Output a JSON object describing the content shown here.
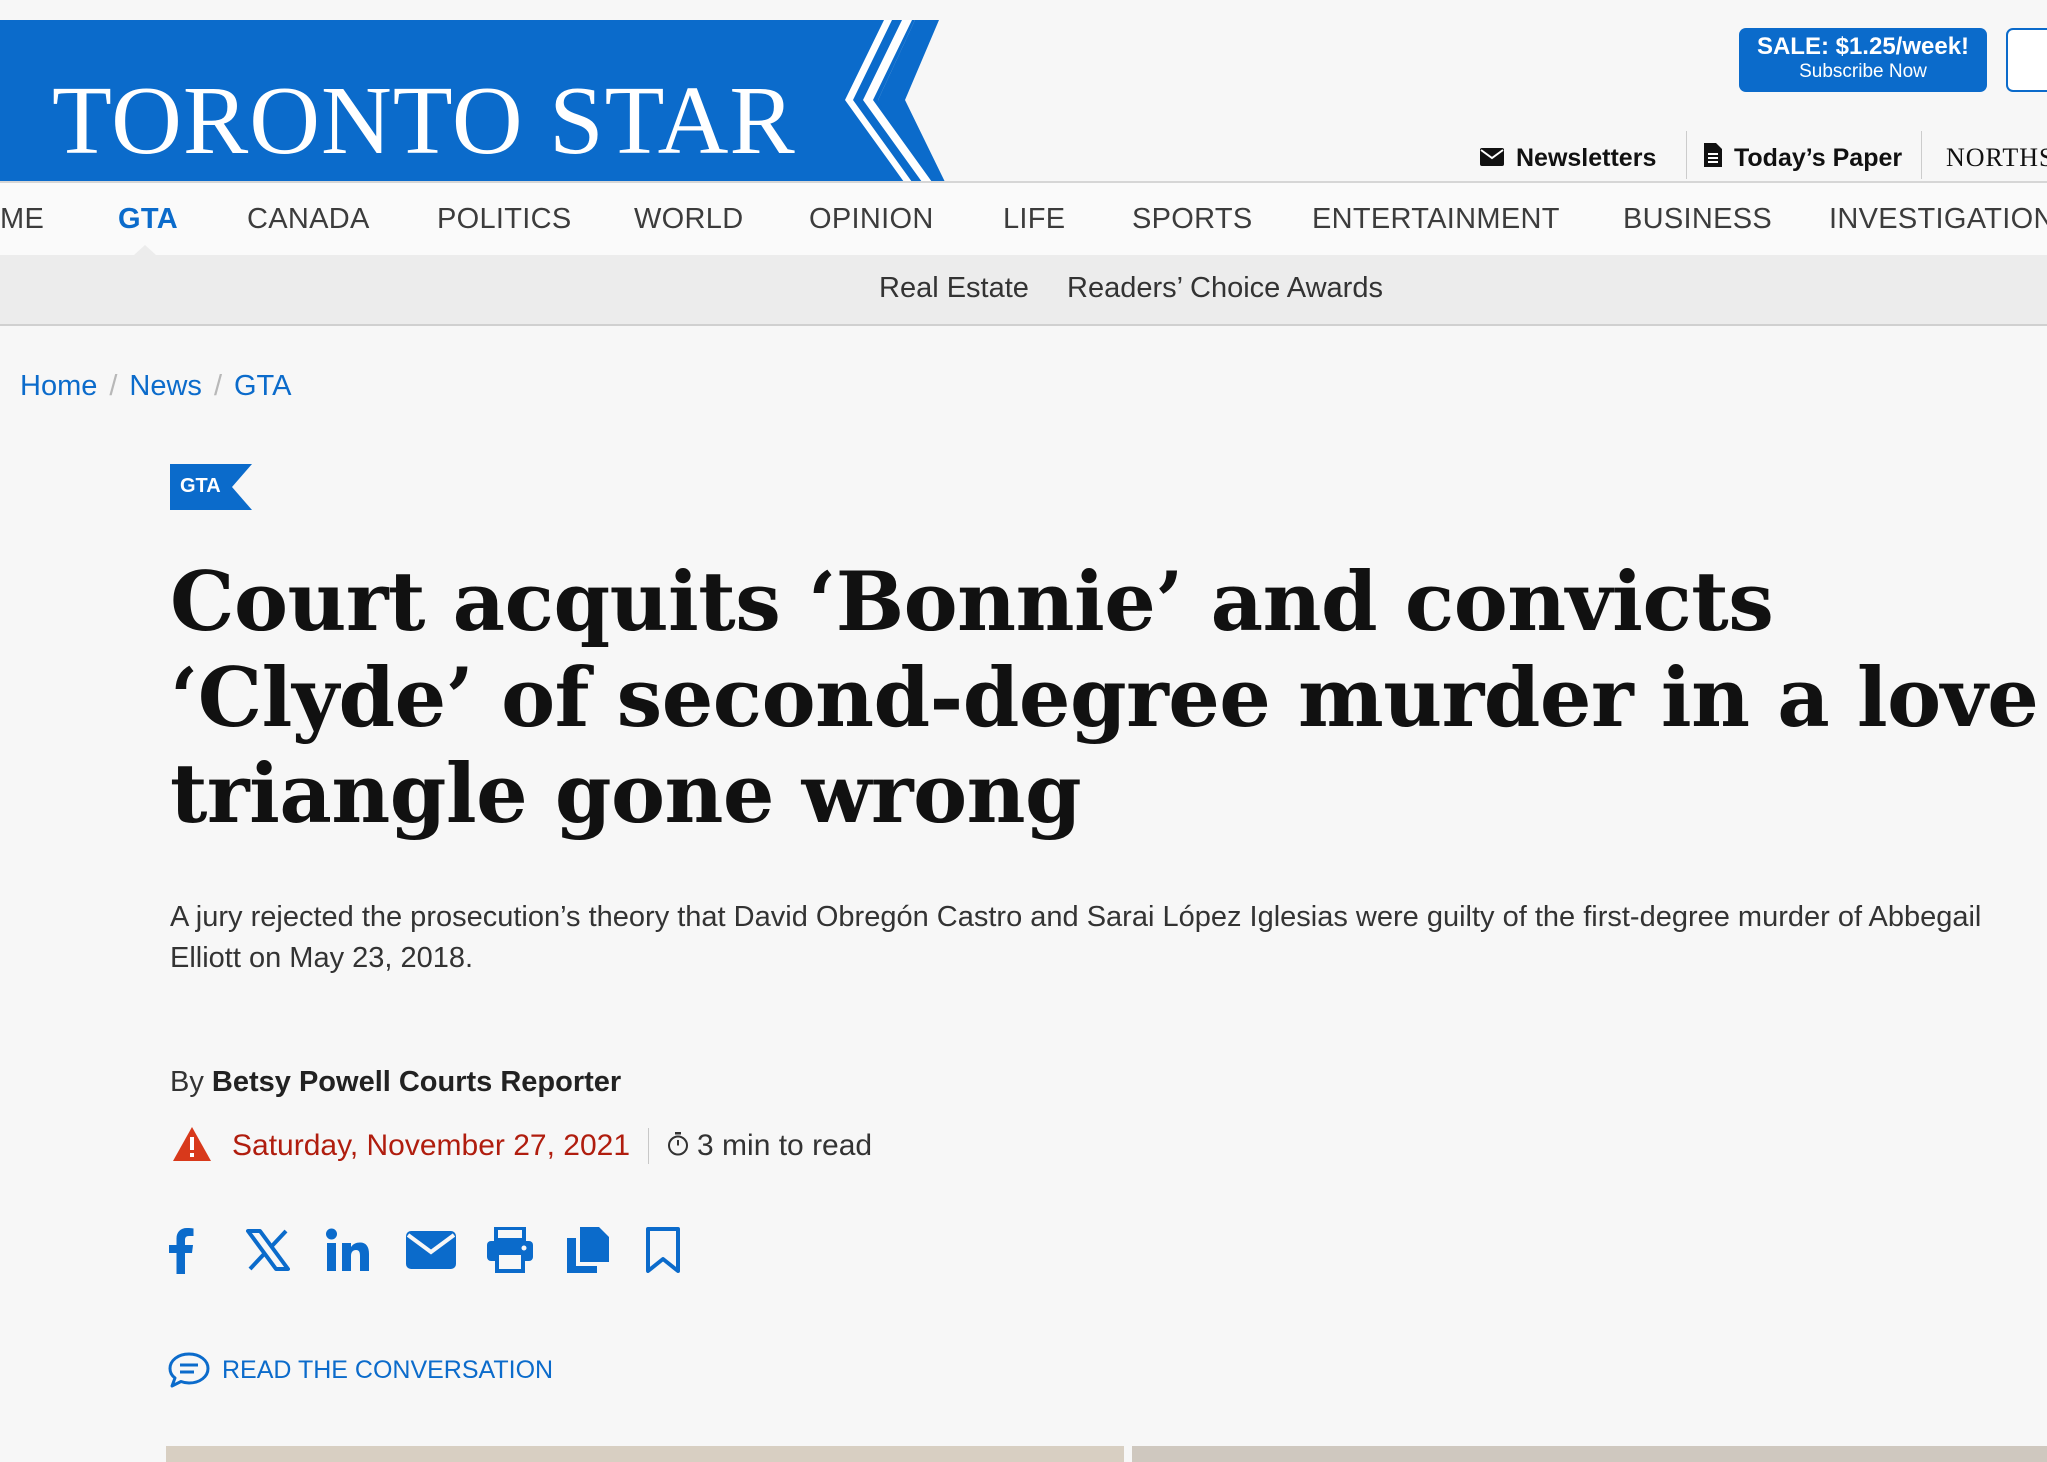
{
  "header": {
    "logo": "TORONTO STAR",
    "subscribe": {
      "sale": "SALE: $1.25/week!",
      "cta": "Subscribe Now"
    },
    "utility_links": [
      {
        "label": "Newsletters",
        "icon": "envelope-icon"
      },
      {
        "label": "Today’s Paper",
        "icon": "document-icon"
      },
      {
        "label": "NORTHST"
      }
    ]
  },
  "main_nav": {
    "items": [
      {
        "label": "ME"
      },
      {
        "label": "GTA",
        "active": true
      },
      {
        "label": "CANADA"
      },
      {
        "label": "POLITICS"
      },
      {
        "label": "WORLD"
      },
      {
        "label": "OPINION"
      },
      {
        "label": "LIFE"
      },
      {
        "label": "SPORTS"
      },
      {
        "label": "ENTERTAINMENT"
      },
      {
        "label": "BUSINESS"
      },
      {
        "label": "INVESTIGATIONS"
      }
    ]
  },
  "sub_nav": {
    "items": [
      {
        "label": "Real Estate"
      },
      {
        "label": "Readers’ Choice Awards"
      }
    ]
  },
  "breadcrumb": [
    "Home",
    "News",
    "GTA"
  ],
  "article": {
    "section": "GTA",
    "headline": "Court acquits ‘Bonnie’ and convicts ‘Clyde’ of second-degree murder in a love triangle gone wrong",
    "dek": "A jury rejected the prosecution’s theory that David Obregón Castro and Sarai López Iglesias were guilty of the first-degree murder of Abbegail Elliott on May 23, 2018.",
    "byline_prefix": "By",
    "author": "Betsy Powell Courts Reporter",
    "date": "Saturday, November 27, 2021",
    "read_time": "3 min to read",
    "share_buttons": [
      "facebook-icon",
      "x-icon",
      "linkedin-icon",
      "email-icon",
      "print-icon",
      "copy-icon",
      "bookmark-icon"
    ],
    "conversation_label": "READ THE CONVERSATION"
  },
  "colors": {
    "brand_blue": "#0b6bcb",
    "date_red": "#b01d0e",
    "alert_orange": "#d8391b"
  }
}
